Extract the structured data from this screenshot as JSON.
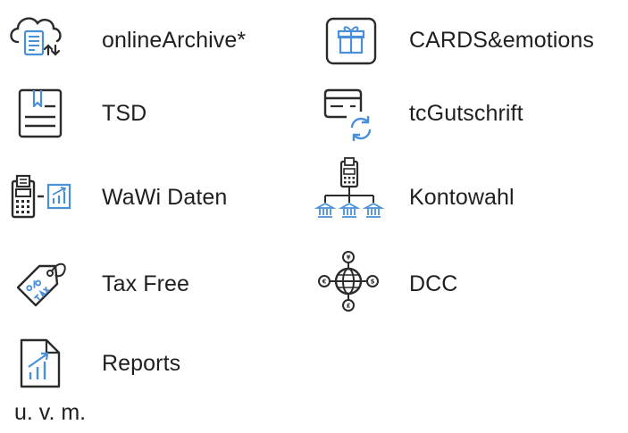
{
  "colors": {
    "line": "#2b2b2b",
    "accent": "#4a90d9"
  },
  "features": {
    "online_archive": {
      "label": "onlineArchive*",
      "icon": "cloud-receipt-icon"
    },
    "cards_emotions": {
      "label": "CARDS&emotions",
      "icon": "gift-card-icon"
    },
    "tsd": {
      "label": "TSD",
      "icon": "document-id-icon"
    },
    "tc_gutschrift": {
      "label": "tcGutschrift",
      "icon": "card-refresh-icon"
    },
    "wawi_daten": {
      "label": "WaWi Daten",
      "icon": "terminal-chart-icon"
    },
    "kontowahl": {
      "label": "Kontowahl",
      "icon": "terminal-banks-icon"
    },
    "tax_free": {
      "label": "Tax Free",
      "icon": "tax-tag-icon"
    },
    "dcc": {
      "label": "DCC",
      "icon": "globe-currency-icon"
    },
    "reports": {
      "label": "Reports",
      "icon": "report-chart-icon"
    }
  },
  "footer": {
    "text": "u. v. m."
  }
}
